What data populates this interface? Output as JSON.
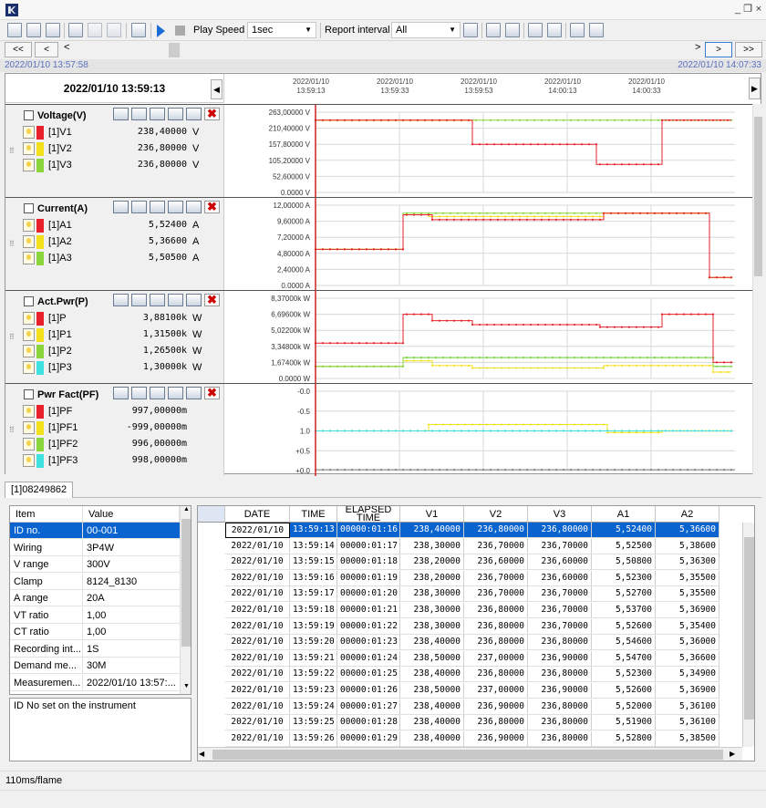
{
  "window": {
    "minimize": "_",
    "restore": "❐",
    "close": "×"
  },
  "toolbar": {
    "play_speed_label": "Play Speed",
    "play_speed_value": "1sec",
    "report_interval_label": "Report interval",
    "report_interval_value": "All"
  },
  "nav": {
    "first": "<<",
    "prev": "<",
    "back": "<",
    "fwd": ">",
    "next": ">",
    "last": ">>"
  },
  "range": {
    "start": "2022/01/10 13:57:58",
    "end": "2022/01/10 14:07:33"
  },
  "cursor_time": "2022/01/10 13:59:13",
  "time_ticks": [
    {
      "date": "2022/01/10",
      "time": "13:59:13"
    },
    {
      "date": "2022/01/10",
      "time": "13:59:33"
    },
    {
      "date": "2022/01/10",
      "time": "13:59:53"
    },
    {
      "date": "2022/01/10",
      "time": "14:00:13"
    },
    {
      "date": "2022/01/10",
      "time": "14:00:33"
    }
  ],
  "colors": {
    "red": "#e8202a",
    "yellow": "#f2e01a",
    "green": "#8ad63a",
    "cyan": "#3ee0e0",
    "cursor": "#cc2222",
    "select": "#0a64d0"
  },
  "panels": [
    {
      "title": "Voltage(V)",
      "yticks": [
        "263,00000 V",
        "210,40000 V",
        "157,80000 V",
        "105,20000 V",
        "52,60000 V",
        "0.0000 V"
      ],
      "rows": [
        {
          "name": "[1]V1",
          "value": "238,40000",
          "unit": "V",
          "color": "#e8202a"
        },
        {
          "name": "[1]V2",
          "value": "236,80000",
          "unit": "V",
          "color": "#f2e01a"
        },
        {
          "name": "[1]V3",
          "value": "236,80000",
          "unit": "V",
          "color": "#8ad63a"
        }
      ]
    },
    {
      "title": "Current(A)",
      "yticks": [
        "12,00000 A",
        "9,60000 A",
        "7,20000 A",
        "4,80000 A",
        "2,40000 A",
        "0.0000 A"
      ],
      "rows": [
        {
          "name": "[1]A1",
          "value": "5,52400",
          "unit": "A",
          "color": "#e8202a"
        },
        {
          "name": "[1]A2",
          "value": "5,36600",
          "unit": "A",
          "color": "#f2e01a"
        },
        {
          "name": "[1]A3",
          "value": "5,50500",
          "unit": "A",
          "color": "#8ad63a"
        }
      ]
    },
    {
      "title": "Act.Pwr(P)",
      "yticks": [
        "8,37000k W",
        "6,69600k W",
        "5,02200k W",
        "3,34800k W",
        "1,67400k W",
        "0.0000 W"
      ],
      "rows": [
        {
          "name": "[1]P",
          "value": "3,88100k",
          "unit": "W",
          "color": "#e8202a"
        },
        {
          "name": "[1]P1",
          "value": "1,31500k",
          "unit": "W",
          "color": "#f2e01a"
        },
        {
          "name": "[1]P2",
          "value": "1,26500k",
          "unit": "W",
          "color": "#8ad63a"
        },
        {
          "name": "[1]P3",
          "value": "1,30000k",
          "unit": "W",
          "color": "#3ee0e0"
        }
      ]
    },
    {
      "title": "Pwr Fact(PF)",
      "yticks": [
        "-0.0",
        "-0.5",
        "1.0",
        "+0.5",
        "+0.0"
      ],
      "rows": [
        {
          "name": "[1]PF",
          "value": "997,00000m",
          "unit": "",
          "color": "#e8202a"
        },
        {
          "name": "[1]PF1",
          "value": "-999,00000m",
          "unit": "",
          "color": "#f2e01a"
        },
        {
          "name": "[1]PF2",
          "value": "996,00000m",
          "unit": "",
          "color": "#8ad63a"
        },
        {
          "name": "[1]PF3",
          "value": "998,00000m",
          "unit": "",
          "color": "#3ee0e0"
        }
      ]
    }
  ],
  "tab": "[1]08249862",
  "info": {
    "col_item": "Item",
    "col_value": "Value",
    "rows": [
      {
        "k": "ID no.",
        "v": "00-001"
      },
      {
        "k": "Wiring",
        "v": "3P4W"
      },
      {
        "k": "V range",
        "v": "300V"
      },
      {
        "k": "Clamp",
        "v": "8124_8130"
      },
      {
        "k": "A range",
        "v": "20A"
      },
      {
        "k": "VT ratio",
        "v": "1,00"
      },
      {
        "k": "CT ratio",
        "v": "1,00"
      },
      {
        "k": "Recording int...",
        "v": "1S"
      },
      {
        "k": "Demand me...",
        "v": "30M"
      },
      {
        "k": "Measuremen...",
        "v": "2022/01/10 13:57:..."
      }
    ],
    "description": "ID No set on the instrument"
  },
  "table": {
    "headers": [
      "DATE",
      "TIME",
      "ELAPSED TIME",
      "V1",
      "V2",
      "V3",
      "A1",
      "A2"
    ],
    "rows": [
      [
        "2022/01/10",
        "13:59:13",
        "00000:01:16",
        "238,40000",
        "236,80000",
        "236,80000",
        "5,52400",
        "5,36600"
      ],
      [
        "2022/01/10",
        "13:59:14",
        "00000:01:17",
        "238,30000",
        "236,70000",
        "236,70000",
        "5,52500",
        "5,38600"
      ],
      [
        "2022/01/10",
        "13:59:15",
        "00000:01:18",
        "238,20000",
        "236,60000",
        "236,60000",
        "5,50800",
        "5,36300"
      ],
      [
        "2022/01/10",
        "13:59:16",
        "00000:01:19",
        "238,20000",
        "236,70000",
        "236,60000",
        "5,52300",
        "5,35500"
      ],
      [
        "2022/01/10",
        "13:59:17",
        "00000:01:20",
        "238,30000",
        "236,70000",
        "236,70000",
        "5,52700",
        "5,35500"
      ],
      [
        "2022/01/10",
        "13:59:18",
        "00000:01:21",
        "238,30000",
        "236,80000",
        "236,70000",
        "5,53700",
        "5,36900"
      ],
      [
        "2022/01/10",
        "13:59:19",
        "00000:01:22",
        "238,30000",
        "236,80000",
        "236,70000",
        "5,52600",
        "5,35400"
      ],
      [
        "2022/01/10",
        "13:59:20",
        "00000:01:23",
        "238,40000",
        "236,80000",
        "236,80000",
        "5,54600",
        "5,36000"
      ],
      [
        "2022/01/10",
        "13:59:21",
        "00000:01:24",
        "238,50000",
        "237,00000",
        "236,90000",
        "5,54700",
        "5,36600"
      ],
      [
        "2022/01/10",
        "13:59:22",
        "00000:01:25",
        "238,40000",
        "236,80000",
        "236,80000",
        "5,52300",
        "5,34900"
      ],
      [
        "2022/01/10",
        "13:59:23",
        "00000:01:26",
        "238,50000",
        "237,00000",
        "236,90000",
        "5,52600",
        "5,36900"
      ],
      [
        "2022/01/10",
        "13:59:24",
        "00000:01:27",
        "238,40000",
        "236,90000",
        "236,80000",
        "5,52000",
        "5,36100"
      ],
      [
        "2022/01/10",
        "13:59:25",
        "00000:01:28",
        "238,40000",
        "236,80000",
        "236,80000",
        "5,51900",
        "5,36100"
      ],
      [
        "2022/01/10",
        "13:59:26",
        "00000:01:29",
        "238,40000",
        "236,90000",
        "236,80000",
        "5,52800",
        "5,38500"
      ]
    ]
  },
  "status": "110ms/flame"
}
